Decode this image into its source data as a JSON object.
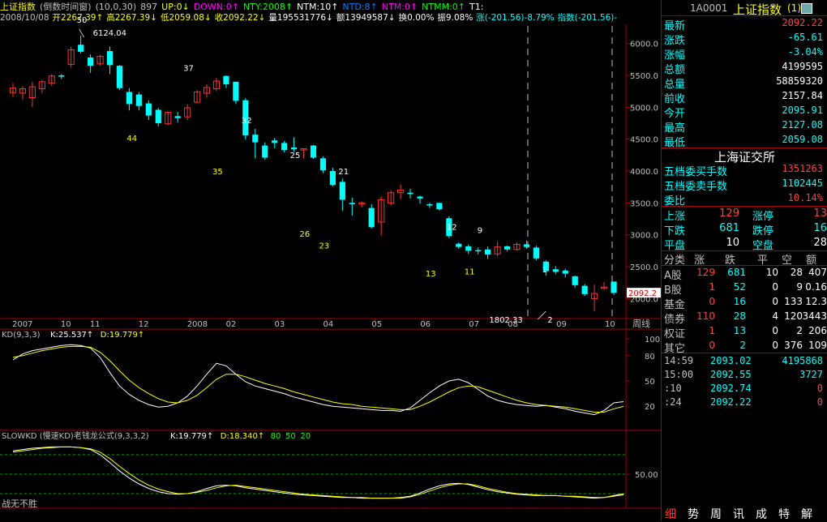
{
  "header": {
    "title": "上证指数",
    "subtitle": "(倒数时间窗)",
    "params": "(10,0,30)",
    "count": "897",
    "indicators": [
      {
        "label": "UP:0↓",
        "color": "#ffff00"
      },
      {
        "label": "DOWN:0↑",
        "color": "#ff00ff"
      },
      {
        "label": "NTY:2008↑",
        "color": "#00ff00"
      },
      {
        "label": "NTM:10↑",
        "color": "#ffffff"
      },
      {
        "label": "NTD:8↑",
        "color": "#0080ff"
      },
      {
        "label": "NTM:0↑",
        "color": "#ff00ff"
      },
      {
        "label": "NTMM:0↑",
        "color": "#00ff00"
      },
      {
        "label": "T1:",
        "color": "#ffffff"
      }
    ]
  },
  "info": {
    "date": "2008/10/08",
    "items": [
      {
        "label": "开2267.39↑",
        "color": "#ffff00"
      },
      {
        "label": "高2267.39↓",
        "color": "#ffff00"
      },
      {
        "label": "低2059.08↓",
        "color": "#ffff00"
      },
      {
        "label": "收2092.22↓",
        "color": "#ffff00"
      },
      {
        "label": "量195531776↓",
        "color": "#ffffff"
      },
      {
        "label": "额13949587↓",
        "color": "#ffffff"
      },
      {
        "label": "换0.00%",
        "color": "#ffffff"
      },
      {
        "label": "振9.08%",
        "color": "#ffffff"
      },
      {
        "label": "涨(-201.56)-8.79%",
        "color": "#00ffff"
      },
      {
        "label": "指数(-201.56)-",
        "color": "#00ffff"
      }
    ]
  },
  "chart_data": [
    {
      "type": "candlestick",
      "title": "周线",
      "ylim": [
        1700,
        6300
      ],
      "yticks": [
        "6000.0",
        "5500.0",
        "5000.0",
        "4500.0",
        "4000.0",
        "3500.0",
        "3000.0",
        "2500.0",
        "2000.0"
      ],
      "xticks": [
        "2007",
        "10",
        "11",
        "12",
        "2008",
        "02",
        "03",
        "04",
        "05",
        "06",
        "07",
        "08",
        "09",
        "10"
      ],
      "last_price_label": "2092.2",
      "x_unit_label": "周线",
      "annotations": [
        {
          "text": "50",
          "color": "#ffffff"
        },
        {
          "text": "6124.04",
          "color": "#ffffff"
        },
        {
          "text": "44",
          "color": "#ffff00"
        },
        {
          "text": "37",
          "color": "#ffffff"
        },
        {
          "text": "35",
          "color": "#ffff00"
        },
        {
          "text": "32",
          "color": "#ffffff"
        },
        {
          "text": "25",
          "color": "#ffffff"
        },
        {
          "text": "26",
          "color": "#ffff00"
        },
        {
          "text": "21",
          "color": "#ffffff"
        },
        {
          "text": "23",
          "color": "#ffff00"
        },
        {
          "text": "12",
          "color": "#ffffff"
        },
        {
          "text": "13",
          "color": "#ffff00"
        },
        {
          "text": "11",
          "color": "#ffff00"
        },
        {
          "text": "9",
          "color": "#ffffff"
        },
        {
          "text": "1",
          "color": "#ffffff"
        },
        {
          "text": "1802.33",
          "color": "#ffffff"
        },
        {
          "text": "2",
          "color": "#ffffff"
        }
      ],
      "candles": [
        {
          "o": 5230,
          "c": 5300,
          "h": 5380,
          "l": 5160
        },
        {
          "o": 5220,
          "c": 5290,
          "h": 5330,
          "l": 5120
        },
        {
          "o": 5150,
          "c": 5320,
          "h": 5400,
          "l": 5000
        },
        {
          "o": 5290,
          "c": 5400,
          "h": 5430,
          "l": 5220
        },
        {
          "o": 5380,
          "c": 5490,
          "h": 5520,
          "l": 5330
        },
        {
          "o": 5500,
          "c": 5480,
          "h": 5520,
          "l": 5440
        },
        {
          "o": 5670,
          "c": 5900,
          "h": 5950,
          "l": 5620
        },
        {
          "o": 5980,
          "c": 5870,
          "h": 6124,
          "l": 5840
        },
        {
          "o": 5780,
          "c": 5650,
          "h": 5830,
          "l": 5540
        },
        {
          "o": 5680,
          "c": 5800,
          "h": 5820,
          "l": 5650
        },
        {
          "o": 5880,
          "c": 5660,
          "h": 5950,
          "l": 5520
        },
        {
          "o": 5650,
          "c": 5300,
          "h": 5660,
          "l": 5270
        },
        {
          "o": 5240,
          "c": 5050,
          "h": 5300,
          "l": 4950
        },
        {
          "o": 5200,
          "c": 5020,
          "h": 5240,
          "l": 4950
        },
        {
          "o": 5060,
          "c": 4870,
          "h": 5110,
          "l": 4800
        },
        {
          "o": 4960,
          "c": 4750,
          "h": 4990,
          "l": 4700
        },
        {
          "o": 4740,
          "c": 4920,
          "h": 4930,
          "l": 4720
        },
        {
          "o": 4860,
          "c": 4830,
          "h": 4930,
          "l": 4760
        },
        {
          "o": 4850,
          "c": 4990,
          "h": 5050,
          "l": 4800
        },
        {
          "o": 5080,
          "c": 5240,
          "h": 5270,
          "l": 5060
        },
        {
          "o": 5220,
          "c": 5310,
          "h": 5360,
          "l": 5150
        },
        {
          "o": 5290,
          "c": 5410,
          "h": 5460,
          "l": 5250
        },
        {
          "o": 5490,
          "c": 5360,
          "h": 5500,
          "l": 5300
        },
        {
          "o": 5400,
          "c": 5100,
          "h": 5400,
          "l": 5050
        },
        {
          "o": 5110,
          "c": 4560,
          "h": 5140,
          "l": 4490
        },
        {
          "o": 4570,
          "c": 4450,
          "h": 4660,
          "l": 4200
        },
        {
          "o": 4400,
          "c": 4210,
          "h": 4450,
          "l": 4180
        },
        {
          "o": 4480,
          "c": 4440,
          "h": 4520,
          "l": 4360
        },
        {
          "o": 4440,
          "c": 4330,
          "h": 4470,
          "l": 4290
        },
        {
          "o": 4370,
          "c": 4340,
          "h": 4530,
          "l": 4300
        },
        {
          "o": 4330,
          "c": 4350,
          "h": 4350,
          "l": 4200
        },
        {
          "o": 4400,
          "c": 4210,
          "h": 4410,
          "l": 4190
        },
        {
          "o": 4200,
          "c": 4010,
          "h": 4230,
          "l": 3970
        },
        {
          "o": 4000,
          "c": 3780,
          "h": 4050,
          "l": 3760
        },
        {
          "o": 3830,
          "c": 3550,
          "h": 3880,
          "l": 3380
        },
        {
          "o": 3500,
          "c": 3480,
          "h": 3580,
          "l": 3300
        },
        {
          "o": 3480,
          "c": 3500,
          "h": 3520,
          "l": 3430
        },
        {
          "o": 3420,
          "c": 3120,
          "h": 3480,
          "l": 3100
        },
        {
          "o": 3200,
          "c": 3550,
          "h": 3600,
          "l": 2990
        },
        {
          "o": 3500,
          "c": 3660,
          "h": 3700,
          "l": 3460
        },
        {
          "o": 3660,
          "c": 3700,
          "h": 3790,
          "l": 3560
        },
        {
          "o": 3660,
          "c": 3640,
          "h": 3720,
          "l": 3570
        },
        {
          "o": 3600,
          "c": 3570,
          "h": 3610,
          "l": 3490
        },
        {
          "o": 3480,
          "c": 3460,
          "h": 3500,
          "l": 3420
        },
        {
          "o": 3500,
          "c": 3400,
          "h": 3500,
          "l": 3380
        },
        {
          "o": 3260,
          "c": 2980,
          "h": 3290,
          "l": 2950
        },
        {
          "o": 2860,
          "c": 2810,
          "h": 2880,
          "l": 2780
        },
        {
          "o": 2820,
          "c": 2750,
          "h": 2850,
          "l": 2700
        },
        {
          "o": 2760,
          "c": 2750,
          "h": 2800,
          "l": 2690
        },
        {
          "o": 2770,
          "c": 2690,
          "h": 2820,
          "l": 2620
        },
        {
          "o": 2700,
          "c": 2810,
          "h": 2900,
          "l": 2660
        },
        {
          "o": 2820,
          "c": 2770,
          "h": 2830,
          "l": 2740
        },
        {
          "o": 2770,
          "c": 2850,
          "h": 2880,
          "l": 2750
        },
        {
          "o": 2850,
          "c": 2810,
          "h": 2910,
          "l": 2780
        },
        {
          "o": 2800,
          "c": 2630,
          "h": 2830,
          "l": 2600
        },
        {
          "o": 2580,
          "c": 2430,
          "h": 2600,
          "l": 2360
        },
        {
          "o": 2460,
          "c": 2420,
          "h": 2510,
          "l": 2380
        },
        {
          "o": 2440,
          "c": 2390,
          "h": 2470,
          "l": 2330
        },
        {
          "o": 2350,
          "c": 2210,
          "h": 2360,
          "l": 2170
        },
        {
          "o": 2200,
          "c": 2070,
          "h": 2230,
          "l": 2040
        },
        {
          "o": 2000,
          "c": 2080,
          "h": 2220,
          "l": 1802
        },
        {
          "o": 2170,
          "c": 2180,
          "h": 2260,
          "l": 2140
        },
        {
          "o": 2267,
          "c": 2092,
          "h": 2267,
          "l": 2059
        }
      ]
    },
    {
      "type": "line",
      "title": "KD(9,3,3)",
      "legend": [
        {
          "name": "K:25.537↑",
          "color": "#ffffff"
        },
        {
          "name": "D:19.779↑",
          "color": "#ffff00"
        }
      ],
      "ylim": [
        0,
        100
      ],
      "yticks": [
        "100",
        "80",
        "50",
        "20"
      ],
      "series": [
        {
          "name": "K",
          "values": [
            75,
            82,
            86,
            88,
            90,
            92,
            93,
            92,
            89,
            78,
            60,
            44,
            34,
            27,
            22,
            19,
            20,
            24,
            32,
            44,
            58,
            71,
            68,
            58,
            49,
            44,
            41,
            38,
            35,
            31,
            28,
            25,
            22,
            20,
            19,
            18,
            17,
            16,
            15,
            15,
            14,
            18,
            27,
            36,
            44,
            50,
            52,
            48,
            40,
            32,
            27,
            24,
            22,
            21,
            20,
            21,
            19,
            17,
            14,
            12,
            10,
            15,
            24,
            25.5
          ]
        },
        {
          "name": "D",
          "values": [
            78,
            80,
            83,
            86,
            88,
            90,
            91,
            91,
            90,
            84,
            74,
            62,
            51,
            42,
            35,
            29,
            25,
            24,
            27,
            33,
            42,
            52,
            58,
            58,
            55,
            51,
            47,
            44,
            41,
            37,
            34,
            31,
            28,
            25,
            23,
            22,
            20,
            19,
            18,
            17,
            16,
            16,
            20,
            25,
            31,
            37,
            42,
            44,
            43,
            39,
            35,
            31,
            27,
            24,
            22,
            21,
            20,
            19,
            17,
            15,
            13,
            13,
            17,
            19.8
          ]
        }
      ]
    },
    {
      "type": "line",
      "title": "SLOWKD (慢速KD)老钱龙公式(9,3,3,2)",
      "legend": [
        {
          "name": "K:19.779↑",
          "color": "#ffffff"
        },
        {
          "name": "D:18.340↑",
          "color": "#ffff00"
        },
        {
          "name": "80",
          "color": "#00ff00"
        },
        {
          "name": "50",
          "color": "#00ff00"
        },
        {
          "name": "20",
          "color": "#00ff00"
        }
      ],
      "ylim": [
        0,
        100
      ],
      "yticks": [
        "50.00"
      ],
      "series": [
        {
          "name": "K",
          "values": [
            86,
            88,
            90,
            91,
            92,
            92,
            92,
            91,
            88,
            80,
            68,
            55,
            44,
            35,
            28,
            23,
            20,
            19,
            20,
            23,
            28,
            32,
            33,
            32,
            29,
            27,
            25,
            23,
            21,
            19,
            18,
            17,
            16,
            15,
            14,
            14,
            13,
            13,
            13,
            13,
            14,
            16,
            21,
            27,
            32,
            35,
            36,
            34,
            30,
            26,
            23,
            21,
            19,
            18,
            17,
            17,
            17,
            16,
            15,
            14,
            13,
            14,
            17,
            19.8
          ]
        },
        {
          "name": "D",
          "values": [
            84,
            86,
            88,
            90,
            91,
            92,
            92,
            91,
            89,
            84,
            74,
            62,
            51,
            41,
            33,
            27,
            23,
            20,
            20,
            22,
            25,
            29,
            32,
            33,
            31,
            29,
            27,
            25,
            23,
            21,
            19,
            18,
            17,
            16,
            15,
            14,
            14,
            13,
            13,
            13,
            13,
            15,
            19,
            24,
            29,
            33,
            35,
            35,
            32,
            28,
            25,
            22,
            20,
            19,
            18,
            17,
            17,
            16,
            16,
            15,
            14,
            14,
            16,
            18.3
          ]
        }
      ]
    }
  ],
  "footer_note": "战无不胜",
  "panel": {
    "code": "1A0001",
    "name": "上证指数",
    "suffix": "(1)",
    "quote": [
      {
        "label": "最新",
        "value": "2092.22",
        "color": "#ff4040"
      },
      {
        "label": "涨跌",
        "value": "-65.61",
        "color": "#00ffff"
      },
      {
        "label": "涨幅",
        "value": "-3.04%",
        "color": "#00ffff"
      },
      {
        "label": "总额",
        "value": "4199595",
        "color": "#ffffff"
      },
      {
        "label": "总量",
        "value": "58859320",
        "color": "#ffffff"
      },
      {
        "label": "前收",
        "value": "2157.84",
        "color": "#ffffff"
      },
      {
        "label": "今开",
        "value": "2095.91",
        "color": "#00ffff"
      },
      {
        "label": "最高",
        "value": "2127.08",
        "color": "#00ffff"
      },
      {
        "label": "最低",
        "value": "2059.08",
        "color": "#00ffff"
      }
    ],
    "exchange": "上海证交所",
    "orders": [
      {
        "label": "五档委买手数",
        "value": "1351263",
        "color": "#ff4040"
      },
      {
        "label": "五档委卖手数",
        "value": "1102445",
        "color": "#00ffff"
      },
      {
        "label": "委比",
        "value": "10.14%",
        "color": "#ff4040"
      }
    ],
    "breadth": [
      {
        "l1": "上涨",
        "v1": "129",
        "c1": "#ff4040",
        "l2": "涨停",
        "v2": "13",
        "c2": "#ff4040"
      },
      {
        "l1": "下跌",
        "v1": "681",
        "c1": "#00ffff",
        "l2": "跌停",
        "v2": "16",
        "c2": "#00ffff"
      },
      {
        "l1": "平盘",
        "v1": "10",
        "c1": "#ffffff",
        "l2": "空盘",
        "v2": "28",
        "c2": "#ffffff"
      }
    ],
    "class_headers": [
      "分类",
      "涨",
      "跌",
      "平",
      "空",
      "额"
    ],
    "classes": [
      {
        "name": "A股",
        "up": "129",
        "down": "681",
        "flat": "10",
        "empty": "28",
        "amount": "407"
      },
      {
        "name": "B股",
        "up": "1",
        "down": "52",
        "flat": "0",
        "empty": "9",
        "amount": "0.16"
      },
      {
        "name": "基金",
        "up": "0",
        "down": "16",
        "flat": "0",
        "empty": "133",
        "amount": "12.3"
      },
      {
        "name": "债券",
        "up": "110",
        "down": "28",
        "flat": "4",
        "empty": "120",
        "amount": "3443"
      },
      {
        "name": "权证",
        "up": "1",
        "down": "13",
        "flat": "0",
        "empty": "2",
        "amount": "206"
      },
      {
        "name": "其它",
        "up": "0",
        "down": "2",
        "flat": "0",
        "empty": "376",
        "amount": "109"
      }
    ],
    "ticks": [
      {
        "time": "14:59",
        "price": "2093.02",
        "vol": "4195868",
        "vcolor": "#00ffff"
      },
      {
        "time": "15:00",
        "price": "2092.55",
        "vol": "3727",
        "vcolor": "#00ffff"
      },
      {
        "time": ":10",
        "price": "2092.74",
        "vol": "0",
        "vcolor": "#ff4040"
      },
      {
        "time": ":24",
        "price": "2092.22",
        "vol": "0",
        "vcolor": "#ff4040"
      }
    ],
    "tabs": [
      "细",
      "势",
      "周",
      "讯",
      "成",
      "特",
      "解"
    ]
  },
  "colors": {
    "up": "#ff3030",
    "down": "#00ffff",
    "grid": "#a00000",
    "panel_label": "#00ffff"
  }
}
